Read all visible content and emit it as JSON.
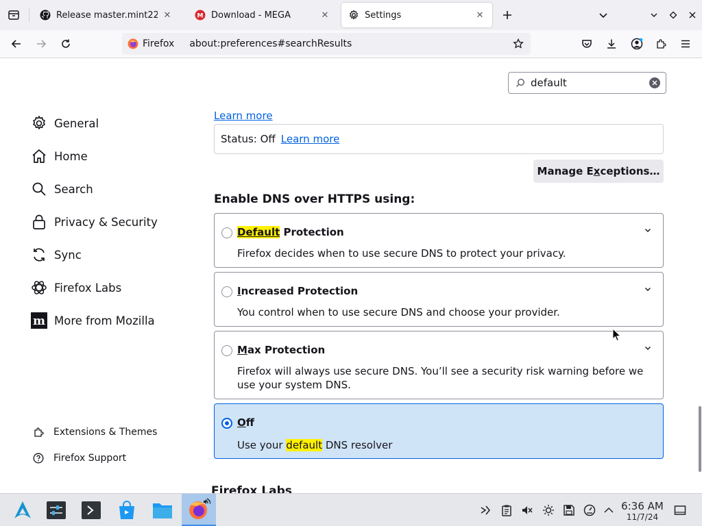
{
  "tabs": [
    {
      "label": "Release master.mint22 · lin",
      "favicon": "github-icon",
      "active": false
    },
    {
      "label": "Download - MEGA",
      "favicon": "mega-icon",
      "active": false
    },
    {
      "label": "Settings",
      "favicon": "gear-icon",
      "active": true
    }
  ],
  "toolbar": {
    "identity_label": "Firefox",
    "url": "about:preferences#searchResults"
  },
  "search": {
    "value": "default"
  },
  "sidebar": {
    "items": [
      {
        "label": "General",
        "icon": "gear-icon"
      },
      {
        "label": "Home",
        "icon": "home-icon"
      },
      {
        "label": "Search",
        "icon": "search-icon"
      },
      {
        "label": "Privacy & Security",
        "icon": "lock-icon"
      },
      {
        "label": "Sync",
        "icon": "sync-icon"
      },
      {
        "label": "Firefox Labs",
        "icon": "labs-icon"
      },
      {
        "label": "More from Mozilla",
        "icon": "mozilla-icon"
      }
    ],
    "footer": [
      {
        "label": "Extensions & Themes",
        "icon": "puzzle-icon"
      },
      {
        "label": "Firefox Support",
        "icon": "help-icon"
      }
    ]
  },
  "main": {
    "learn_more_top": "Learn more",
    "status_label": "Status: Off",
    "status_link": "Learn more",
    "manage_exceptions": {
      "before": "Manage E",
      "mnemonic": "x",
      "after": "ceptions…"
    },
    "doh_heading": "Enable DNS over HTTPS using:",
    "options": [
      {
        "title_highlight": "Default",
        "title_rest": " Protection",
        "desc": "Firefox decides when to use secure DNS to protect your privacy.",
        "selected": false
      },
      {
        "title_first": "I",
        "title_rest": "ncreased Protection",
        "desc": "You control when to use secure DNS and choose your provider.",
        "selected": false
      },
      {
        "title_first": "M",
        "title_rest": "ax Protection",
        "desc": "Firefox will always use secure DNS. You’ll see a security risk warning before we use your system DNS.",
        "selected": false
      },
      {
        "title_first": "O",
        "title_rest": "ff",
        "desc_before": "Use your ",
        "desc_highlight": "default",
        "desc_after": " DNS resolver",
        "selected": true
      }
    ],
    "labs_heading": "Firefox Labs"
  },
  "taskbar": {
    "time": "6:36 AM",
    "date": "11/7/24"
  },
  "colors": {
    "accent": "#0061e0",
    "highlight": "#fff100",
    "selected_bg": "#d0e4f7"
  }
}
